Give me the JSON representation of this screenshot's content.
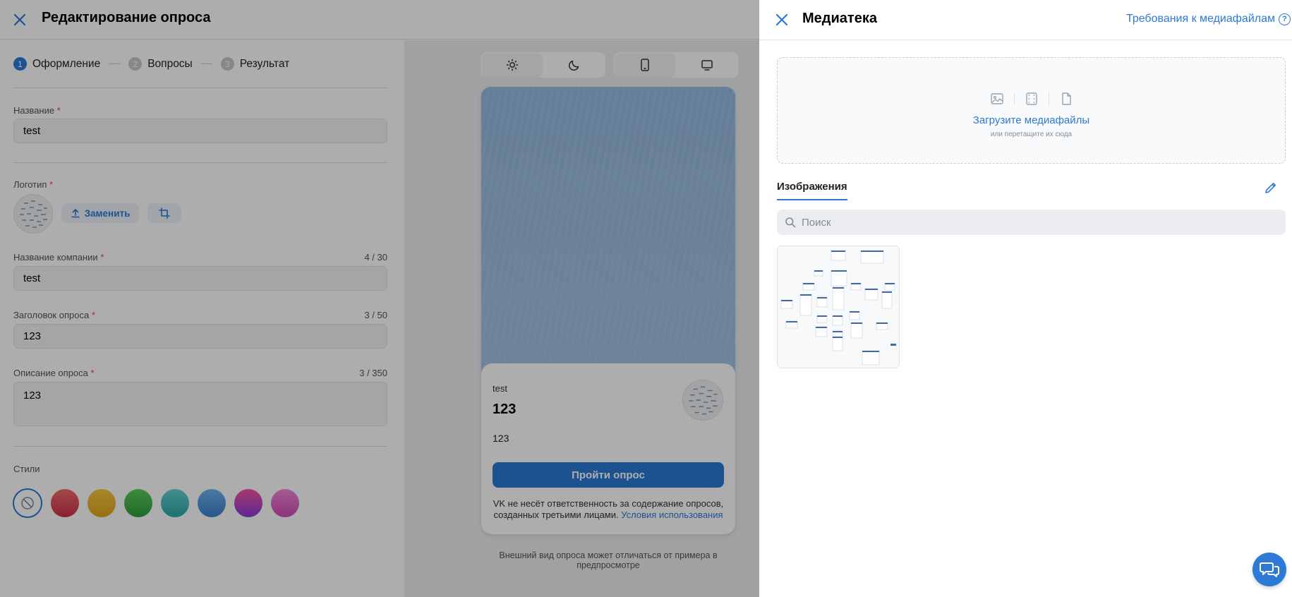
{
  "editor": {
    "title": "Редактирование опроса",
    "steps": [
      {
        "num": "1",
        "label": "Оформление"
      },
      {
        "num": "2",
        "label": "Вопросы"
      },
      {
        "num": "3",
        "label": "Результат"
      }
    ],
    "fields": {
      "name": {
        "label": "Название",
        "value": "test"
      },
      "logo": {
        "label": "Логотип",
        "replace_label": "Заменить"
      },
      "company": {
        "label": "Название компании",
        "value": "test",
        "counter": "4 / 30"
      },
      "heading": {
        "label": "Заголовок опроса",
        "value": "123",
        "counter": "3 / 50"
      },
      "description": {
        "label": "Описание опроса",
        "value": "123",
        "counter": "3 / 350"
      }
    },
    "required_mark": "*",
    "styles": {
      "label": "Стили",
      "swatches": [
        {
          "name": "none"
        },
        {
          "name": "red",
          "from": "#f26d6d",
          "to": "#c73044"
        },
        {
          "name": "yellow",
          "from": "#f6c744",
          "to": "#e2a51c"
        },
        {
          "name": "green",
          "from": "#5ccf5c",
          "to": "#2e9c3a"
        },
        {
          "name": "teal",
          "from": "#66d1cf",
          "to": "#2ba8a6"
        },
        {
          "name": "blue",
          "from": "#6fb2f0",
          "to": "#3b81cc"
        },
        {
          "name": "magenta",
          "from": "#f454a4",
          "to": "#8a3dd8"
        },
        {
          "name": "pink",
          "from": "#f08ad8",
          "to": "#d34ab8"
        }
      ]
    }
  },
  "preview": {
    "theme_options": [
      "light",
      "dark"
    ],
    "device_options": [
      "mobile",
      "desktop"
    ],
    "card": {
      "company": "test",
      "title": "123",
      "description": "123",
      "button": "Пройти опрос",
      "disclaimer": "VK не несёт ответственность за содержание опросов, созданных третьими лицами.",
      "terms_link": "Условия использования"
    },
    "note": "Внешний вид опроса может отличаться от примера в предпросмотре"
  },
  "media": {
    "title": "Медиатека",
    "requirements_link": "Требования к медиафайлам",
    "upload": {
      "main": "Загрузите медиафайлы",
      "sub": "или перетащите их сюда"
    },
    "tab": "Изображения",
    "search_placeholder": "Поиск",
    "images_count": 1
  },
  "colors": {
    "accent": "#2c7ad6",
    "required": "#e64646"
  }
}
